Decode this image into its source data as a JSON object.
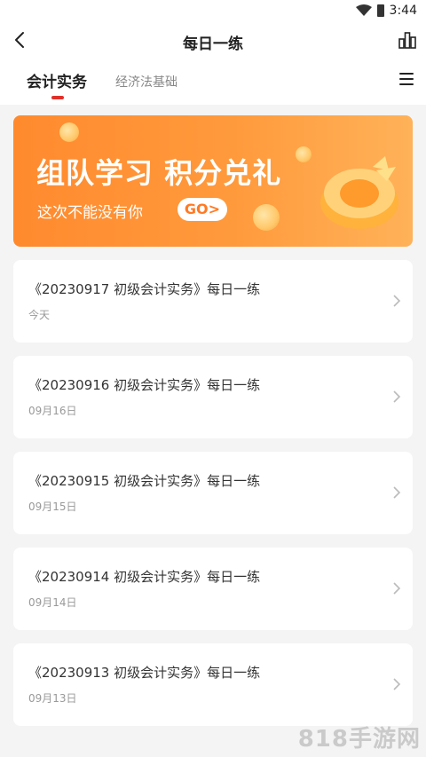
{
  "status_bar": {
    "time": "3:44"
  },
  "header": {
    "title": "每日一练"
  },
  "tabs": [
    {
      "label": "会计实务",
      "active": true
    },
    {
      "label": "经济法基础",
      "active": false
    }
  ],
  "banner": {
    "headline": "组队学习 积分兑礼",
    "subtitle": "这次不能没有你",
    "go_label": "GO>"
  },
  "practice_list": [
    {
      "title": "《20230917 初级会计实务》每日一练",
      "date": "今天"
    },
    {
      "title": "《20230916 初级会计实务》每日一练",
      "date": "09月16日"
    },
    {
      "title": "《20230915 初级会计实务》每日一练",
      "date": "09月15日"
    },
    {
      "title": "《20230914 初级会计实务》每日一练",
      "date": "09月14日"
    },
    {
      "title": "《20230913 初级会计实务》每日一练",
      "date": "09月13日"
    }
  ],
  "watermark": "818手游网",
  "colors": {
    "accent": "#e0302a",
    "banner_orange": "#ff8a2e",
    "background": "#f4f4f4"
  },
  "icons": [
    "back-arrow-icon",
    "stats-icon",
    "menu-icon",
    "chevron-right-icon",
    "wifi-icon",
    "battery-icon"
  ]
}
